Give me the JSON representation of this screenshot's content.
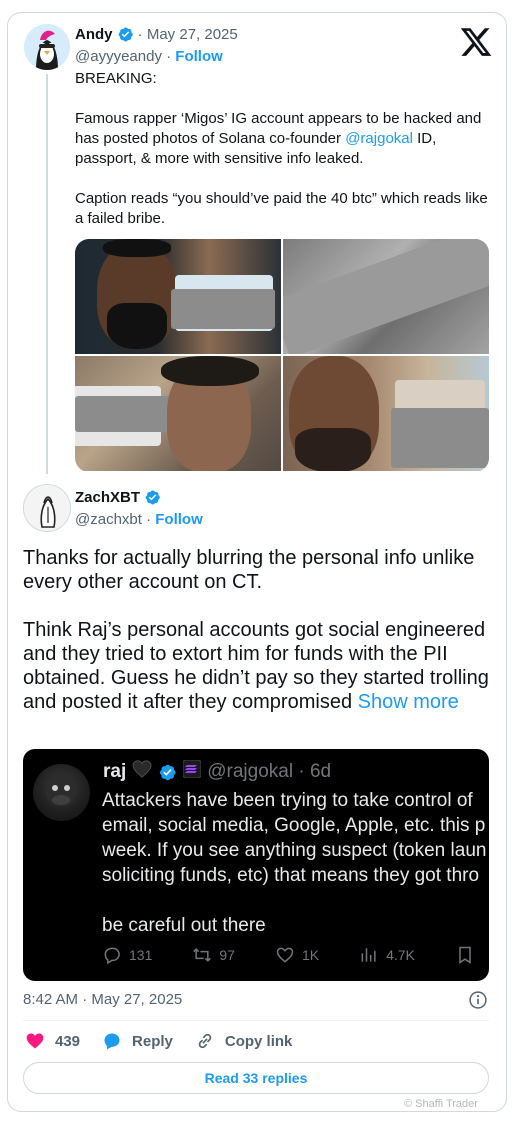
{
  "quoted": {
    "name": "Andy",
    "date": "May 27, 2025",
    "handle": "@ayyyeandy",
    "follow": "Follow",
    "breaking": "BREAKING:",
    "para1_a": "Famous rapper ‘Migos’ IG account appears to be hacked and has posted photos of Solana co-founder ",
    "para1_mention": "@rajgokal",
    "para1_b": " ID, passport, & more with sensitive info leaked.",
    "para2": "Caption reads “you should’ve paid the 40 btc” which reads like a failed bribe."
  },
  "main": {
    "name": "ZachXBT",
    "handle": "@zachxbt",
    "follow": "Follow",
    "para1": "Thanks for actually blurring the personal info unlike every other account on CT.",
    "para2": "Think Raj’s personal accounts got social engineered and they tried to extort him for funds with the PII obtained. Guess he didn’t pay so they started trolling and posted it after they compromised ",
    "show_more": "Show more"
  },
  "embed": {
    "name": "raj",
    "handle": "@rajgokal",
    "age": "6d",
    "lines": [
      "Attackers have been trying to take control of",
      "email, social media, Google, Apple, etc. this p",
      "week. If you see anything suspect (token laun",
      "soliciting funds, etc) that means they got thro"
    ],
    "last_line": "be careful out there",
    "replies": "131",
    "retweets": "97",
    "likes": "1K",
    "views": "4.7K"
  },
  "footer": {
    "timestamp": "8:42 AM · May 27, 2025",
    "likes": "439",
    "reply": "Reply",
    "copy_link": "Copy link",
    "read_replies": "Read 33 replies",
    "watermark": "© Shaffi Trader"
  },
  "colors": {
    "accent": "#1d9bf0",
    "like": "#f91880",
    "text": "#0f1419",
    "muted": "#536471"
  }
}
